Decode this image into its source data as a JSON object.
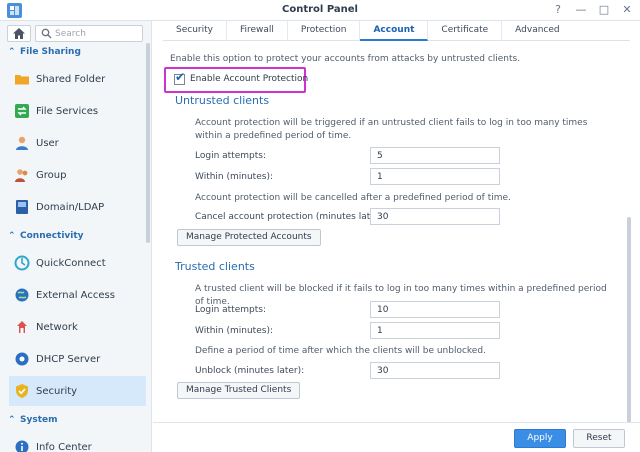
{
  "window": {
    "title": "Control Panel",
    "app_icon": "control-panel-icon",
    "controls": [
      "help-icon",
      "minimize-icon",
      "maximize-icon",
      "close-icon"
    ]
  },
  "sidebar": {
    "home_icon": "home-icon",
    "search": {
      "placeholder": "Search",
      "value": ""
    },
    "sections": [
      {
        "label": "File Sharing"
      },
      {
        "label": "Connectivity"
      },
      {
        "label": "System"
      }
    ],
    "items": [
      {
        "label": "Shared Folder",
        "icon": "folder-icon"
      },
      {
        "label": "File Services",
        "icon": "file-services-icon"
      },
      {
        "label": "User",
        "icon": "user-icon"
      },
      {
        "label": "Group",
        "icon": "group-icon"
      },
      {
        "label": "Domain/LDAP",
        "icon": "domain-icon"
      },
      {
        "label": "QuickConnect",
        "icon": "quickconnect-icon"
      },
      {
        "label": "External Access",
        "icon": "globe-icon"
      },
      {
        "label": "Network",
        "icon": "network-icon"
      },
      {
        "label": "DHCP Server",
        "icon": "dhcp-icon"
      },
      {
        "label": "Security",
        "icon": "shield-icon",
        "active": true
      },
      {
        "label": "Info Center",
        "icon": "info-icon"
      }
    ]
  },
  "tabs": [
    {
      "label": "Security"
    },
    {
      "label": "Firewall"
    },
    {
      "label": "Protection"
    },
    {
      "label": "Account",
      "active": true
    },
    {
      "label": "Certificate"
    },
    {
      "label": "Advanced"
    }
  ],
  "main": {
    "intro": "Enable this option to protect your accounts from attacks by untrusted clients.",
    "enable_label": "Enable Account Protection",
    "enable_checked": true,
    "untrusted": {
      "title": "Untrusted clients",
      "desc1": "Account protection will be triggered if an untrusted client fails to log in too many times within a predefined period of time.",
      "login_attempts_label": "Login attempts:",
      "login_attempts_value": "5",
      "within_label": "Within (minutes):",
      "within_value": "1",
      "desc2": "Account protection will be cancelled after a predefined period of time.",
      "cancel_label": "Cancel account protection (minutes later):",
      "cancel_value": "30",
      "manage_button": "Manage Protected Accounts"
    },
    "trusted": {
      "title": "Trusted clients",
      "desc1": "A trusted client will be blocked if it fails to log in too many times within a predefined period of time.",
      "login_attempts_label": "Login attempts:",
      "login_attempts_value": "10",
      "within_label": "Within (minutes):",
      "within_value": "1",
      "desc2": "Define a period of time after which the clients will be unblocked.",
      "unblock_label": "Unblock (minutes later):",
      "unblock_value": "30",
      "manage_button": "Manage Trusted Clients"
    }
  },
  "footer": {
    "apply": "Apply",
    "reset": "Reset"
  },
  "colors": {
    "accent": "#2a6db0",
    "apply_bg": "#3b8ee5",
    "highlight": "#cc33cc",
    "active_item": "#d6e9fb"
  }
}
